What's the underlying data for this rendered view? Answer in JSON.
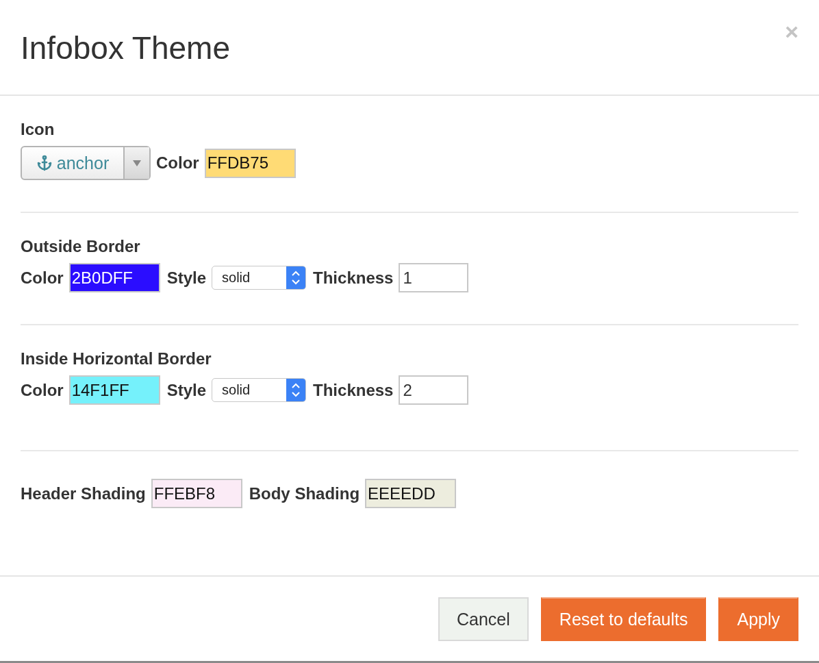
{
  "dialog": {
    "title": "Infobox Theme",
    "close": "×"
  },
  "sections": [
    {
      "heading": "Icon",
      "fields": [
        {
          "kind": "icon_select",
          "value": "anchor"
        },
        {
          "kind": "color",
          "label": "Color",
          "value": "FFDB75",
          "color": "#ffdb75"
        }
      ]
    },
    {
      "heading": "Outside Border",
      "fields": [
        {
          "kind": "color",
          "label": "Color",
          "value": "2B0DFF",
          "color": "#2b0dff"
        },
        {
          "kind": "select",
          "label": "Style",
          "value": "solid"
        },
        {
          "kind": "text",
          "label": "Thickness",
          "value": "1"
        }
      ]
    },
    {
      "heading": "Inside Horizontal Border",
      "fields": [
        {
          "kind": "color",
          "label": "Color",
          "value": "14F1FF",
          "color": "#75f1fb"
        },
        {
          "kind": "select",
          "label": "Style",
          "value": "solid"
        },
        {
          "kind": "text",
          "label": "Thickness",
          "value": "2"
        }
      ]
    },
    {
      "fields": [
        {
          "kind": "color",
          "label": "Header Shading",
          "value": "FFEBF8",
          "color": "#fbebf6"
        },
        {
          "kind": "color",
          "label": "Body Shading",
          "value": "EEEEDD",
          "color": "#ededde"
        }
      ]
    }
  ],
  "buttons": [
    {
      "label": "Cancel",
      "kind": "secondary"
    },
    {
      "label": "Reset to defaults",
      "kind": "primary"
    },
    {
      "label": "Apply",
      "kind": "primary"
    }
  ]
}
